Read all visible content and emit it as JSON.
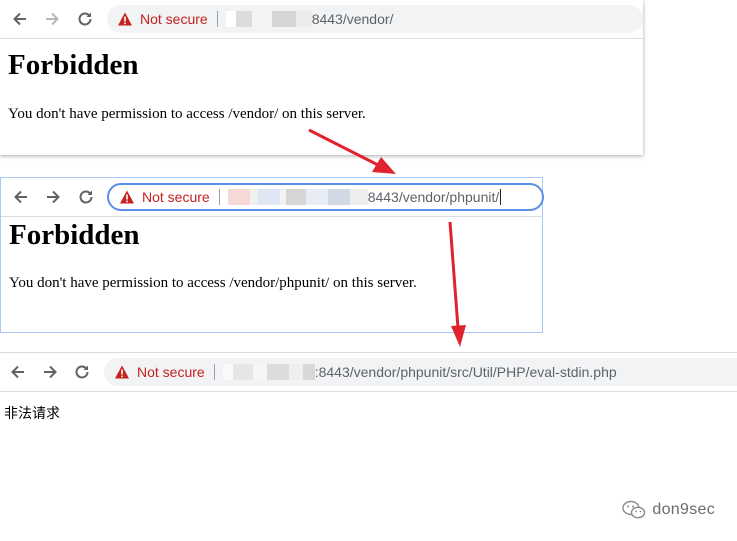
{
  "icons": {
    "back": "arrow-left-icon",
    "forward": "arrow-right-icon",
    "reload": "reload-icon",
    "security": "warning-triangle-icon",
    "watermark": "wechat-icon"
  },
  "colors": {
    "not_secure": "#c5221f",
    "arrow": "#e0242f",
    "focus_border": "#5b8ee6"
  },
  "windows": [
    {
      "security_label": "Not secure",
      "url": "8443/vendor/",
      "heading": "Forbidden",
      "message": "You don't have permission to access /vendor/ on this server."
    },
    {
      "security_label": "Not secure",
      "url": "8443/vendor/phpunit/",
      "heading": "Forbidden",
      "message": "You don't have permission to access /vendor/phpunit/ on this server."
    },
    {
      "security_label": "Not secure",
      "url": ":8443/vendor/phpunit/src/Util/PHP/eval-stdin.php",
      "body_text": "非法请求"
    }
  ],
  "watermark": {
    "text": "don9sec"
  }
}
